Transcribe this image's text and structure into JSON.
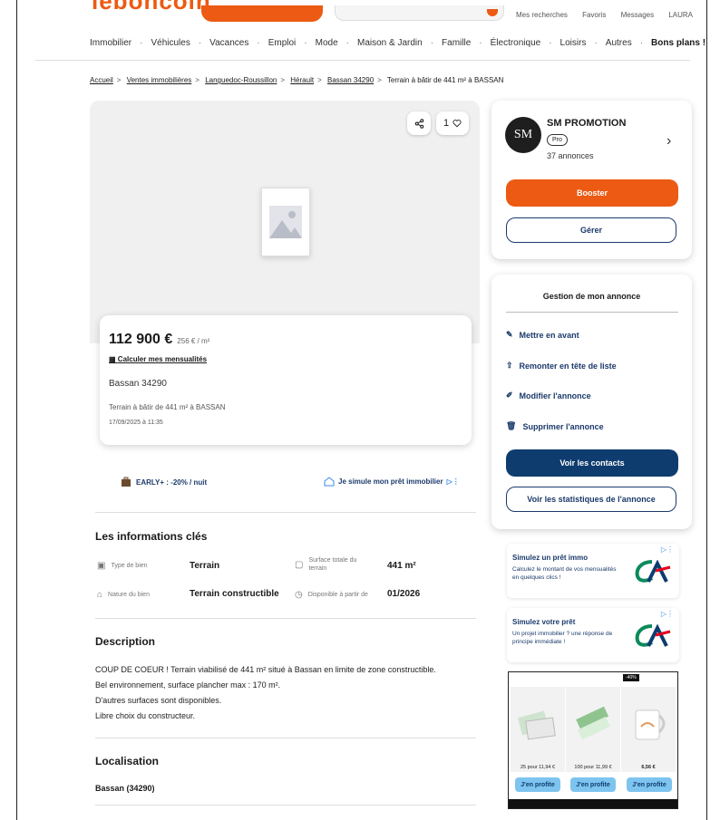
{
  "header": {
    "logo_text": "leboncoin",
    "top_links": [
      "Mes recherches",
      "Favoris",
      "Messages",
      "LAURA"
    ],
    "nav": [
      "Immobilier",
      "Véhicules",
      "Vacances",
      "Emploi",
      "Mode",
      "Maison & Jardin",
      "Famille",
      "Électronique",
      "Loisirs",
      "Autres",
      "Bons plans !"
    ]
  },
  "breadcrumb": [
    "Accueil",
    "Ventes immobilières",
    "Languedoc-Roussillon",
    "Hérault",
    "Bassan 34290",
    "Terrain à bâtir de 441 m² à BASSAN"
  ],
  "gallery": {
    "favorite_count": "1"
  },
  "listing": {
    "price": "112 900 €",
    "price_per_m2": "256 € / m²",
    "calc_link": "Calculer mes mensualités",
    "city": "Bassan 34290",
    "title": "Terrain à bâtir de 441 m² à BASSAN",
    "date": "17/09/2025 à 11:35"
  },
  "promos": {
    "left": "EARLY+ : -20% / nuit",
    "right": "Je simule mon prêt immobilier"
  },
  "key_info": {
    "title": "Les informations clés",
    "items": [
      {
        "label": "Type de bien",
        "value": "Terrain"
      },
      {
        "label": "Surface totale du terrain",
        "value": "441 m²"
      },
      {
        "label": "Nature du bien",
        "value": "Terrain constructible"
      },
      {
        "label": "Disponible à partir de",
        "value": "01/2026"
      }
    ]
  },
  "description": {
    "title": "Description",
    "lines": [
      "COUP DE COEUR ! Terrain viabilisé de 441 m² situé à Bassan en limite de zone constructible.",
      "Bel environnement, surface plancher max : 170 m².",
      "D'autres surfaces sont disponibles.",
      "Libre choix du constructeur."
    ]
  },
  "location": {
    "title": "Localisation",
    "city": "Bassan (34290)"
  },
  "seller": {
    "logo_text": "SM",
    "name": "SM PROMOTION",
    "badge": "Pro",
    "count": "37 annonces",
    "booster_label": "Booster",
    "manage_label": "Gérer"
  },
  "manage": {
    "title": "Gestion de mon annonce",
    "items": [
      "Mettre en avant",
      "Remonter en tête de liste",
      "Modifier l'annonce",
      "Supprimer l'annonce"
    ],
    "contacts_label": "Voir les contacts",
    "stats_label": "Voir les statistiques de l'annonce"
  },
  "ads": [
    {
      "title": "Simulez un prêt immo",
      "text": "Calculez le montant de vos mensualités en quelques clics !"
    },
    {
      "title": "Simulez votre prêt",
      "text": "Un projet immobilier ? une réponse de principe immédiate !"
    }
  ],
  "shop_ad": {
    "badge": "-40%",
    "products": [
      {
        "price": "25 pour 11,94 €",
        "button": "J'en profite"
      },
      {
        "price": "100 pour 11,99 €",
        "button": "J'en profite"
      },
      {
        "price": "6,56 €",
        "button": "J'en profite"
      }
    ]
  },
  "colors": {
    "brand": "#ec5a13",
    "navy": "#0f3c6e",
    "link": "#1b3a6b",
    "ad_red": "#e3001b",
    "ad_green": "#0b8a5b"
  }
}
